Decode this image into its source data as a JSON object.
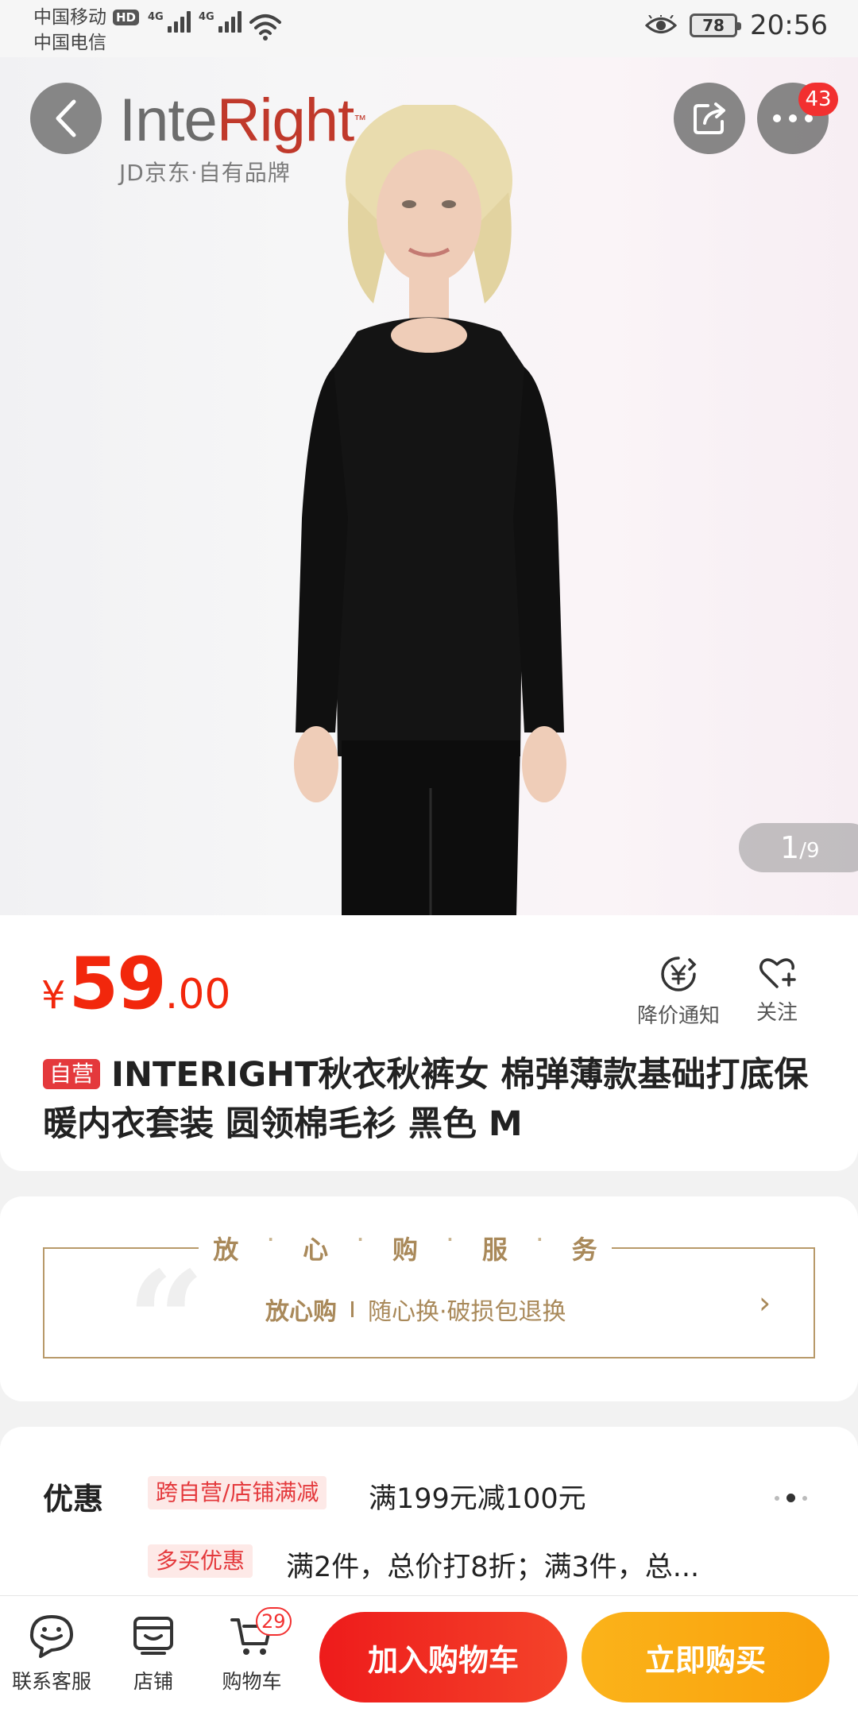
{
  "status_bar": {
    "carrier1": "中国移动",
    "hd": "HD",
    "carrier2": "中国电信",
    "net1": "4G",
    "net2": "4G",
    "battery": "78",
    "time": "20:56"
  },
  "hero": {
    "brand_part1": "Inte",
    "brand_part2": "Right",
    "brand_tm": "™",
    "brand_sub": "JD京东·自有品牌",
    "more_badge": "43",
    "pager_current": "1",
    "pager_total": "/9"
  },
  "product": {
    "price_symbol": "¥",
    "price_int": "59",
    "price_dec": ".00",
    "price_alert_label": "降价通知",
    "follow_label": "关注",
    "self_tag": "自营",
    "title": "INTERIGHT秋衣秋裤女 棉弹薄款基础打底保暖内衣套装 圆领棉毛衫 黑色 M"
  },
  "service": {
    "header_chars": [
      "放",
      "心",
      "购",
      "服",
      "务"
    ],
    "header_sep": "·",
    "strong": "放心购",
    "detail": "随心换·破损包退换",
    "chevron": "›",
    "quote": "“"
  },
  "promo": {
    "title": "优惠",
    "tag1": "跨自营/店铺满减",
    "text1": "满199元减100元",
    "tag2": "多买优惠",
    "text2": "满2件，总价打8折；满3件，总..."
  },
  "bottom_bar": {
    "service_label": "联系客服",
    "shop_label": "店铺",
    "cart_label": "购物车",
    "cart_badge": "29",
    "add_cart": "加入购物车",
    "buy_now": "立即购买"
  },
  "colors": {
    "price_red": "#f2270c",
    "gold": "#a9895a",
    "cta_red": "#ee1b1b",
    "cta_orange": "#fbb31a"
  }
}
